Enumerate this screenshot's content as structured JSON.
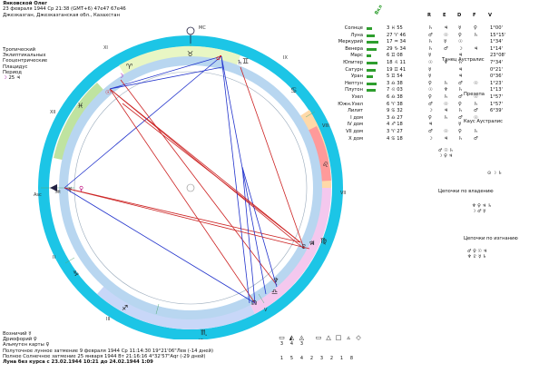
{
  "header": {
    "name": "Янковской Олег",
    "date_line": "23 февраля 1944 Ср 21:38 (GMT+6) 47e47 67e46",
    "place": "Джезказган, Джезказганская обл., Казахстан",
    "system_lines": [
      "Тропический",
      "Эклиптикальных",
      "Геоцентрические",
      "Плацидус"
    ],
    "period_label": "Период",
    "period_value": "25"
  },
  "wheel": {
    "houses": {
      "mc": "MC",
      "asc": "Asc",
      "cusp_labels": [
        "XI",
        "XII",
        "II",
        "III",
        "IC",
        "V",
        "VI",
        "VII",
        "VIII",
        "IX"
      ]
    },
    "colors": {
      "ring": "#1cc5e6",
      "sector_a": "#ffd9a8",
      "sector_b": "#e8f6c4",
      "sector_c": "#f4c8ee",
      "sector_d": "#c8d7f8",
      "sector_e": "#ffd6d6"
    }
  },
  "table": {
    "headers": [
      "Вкл",
      "R",
      "E",
      "D",
      "F",
      "V"
    ],
    "rows": [
      {
        "name": "Солнце",
        "power": 0.4,
        "pos": "3 ♓ 55",
        "c1": "♄",
        "c2": "♃",
        "c3": "☿",
        "c4": "♀",
        "angle": "1°00'"
      },
      {
        "name": "Луна",
        "power": 0.55,
        "pos": "27 ♈ 46",
        "c1": "♂",
        "c2": "☉",
        "c3": "♀",
        "c4": "♄",
        "angle": "15°15'"
      },
      {
        "name": "Меркурий",
        "power": 0.8,
        "pos": "17 ♒ 34",
        "c1": "♄",
        "c2": "☿",
        "c3": "☉",
        "c4": "",
        "angle": "1°34'"
      },
      {
        "name": "Венера",
        "power": 0.7,
        "pos": "29 ♑ 34",
        "c1": "♄",
        "c2": "♂",
        "c3": "☽",
        "c4": "♃",
        "angle": "1°14'"
      },
      {
        "name": "Марс",
        "power": 0.3,
        "pos": "6 ♊ 08",
        "c1": "☿",
        "c2": "",
        "c3": "♃",
        "c4": "",
        "angle": "23°08'"
      },
      {
        "name": "Юпитер",
        "power": 0.75,
        "pos": "18 ♌ 11",
        "c1": "☉",
        "c2": "♆",
        "c3": "♄",
        "c4": "",
        "angle": "7°34'"
      },
      {
        "name": "Сатурн",
        "power": 0.6,
        "pos": "19 ♊ 41",
        "c1": "☿",
        "c2": "",
        "c3": "♃",
        "c4": "",
        "angle": "0°21'"
      },
      {
        "name": "Уран",
        "power": 0.45,
        "pos": "5 ♊ 54",
        "c1": "☿",
        "c2": "",
        "c3": "♃",
        "c4": "",
        "angle": "0°36'"
      },
      {
        "name": "Нептун",
        "power": 0.7,
        "pos": "3 ♎ 38",
        "c1": "♀",
        "c2": "♄",
        "c3": "♂",
        "c4": "☉",
        "angle": "1°23'"
      },
      {
        "name": "Плутон",
        "power": 0.65,
        "pos": "7 ♌ 03",
        "c1": "☉",
        "c2": "♆",
        "c3": "♄",
        "c4": "",
        "angle": "1°13'"
      },
      {
        "name": "Узел",
        "power": 0,
        "pos": "6 ♎ 38",
        "c1": "♀",
        "c2": "♄",
        "c3": "♂",
        "c4": "☉",
        "angle": "1°57'"
      },
      {
        "name": "Южн.Узел",
        "power": 0,
        "pos": "6 ♈ 38",
        "c1": "♂",
        "c2": "☉",
        "c3": "♀",
        "c4": "♄",
        "angle": "1°57'"
      },
      {
        "name": "Лилит",
        "power": 0,
        "pos": "9 ♋ 32",
        "c1": "☽",
        "c2": "♃",
        "c3": "♄",
        "c4": "♂",
        "angle": "6°39'"
      },
      {
        "name": "I дом",
        "power": 0,
        "pos": "3 ♎ 27",
        "c1": "♀",
        "c2": "♄",
        "c3": "♂",
        "c4": "☉",
        "angle": ""
      },
      {
        "name": "IV дом",
        "power": 0,
        "pos": "4 ♐ 18",
        "c1": "♃",
        "c2": "",
        "c3": "☿",
        "c4": "",
        "angle": ""
      },
      {
        "name": "VII дом",
        "power": 0,
        "pos": "3 ♈ 27",
        "c1": "♂",
        "c2": "☉",
        "c3": "♀",
        "c4": "♄",
        "angle": ""
      },
      {
        "name": "X дом",
        "power": 0,
        "pos": "4 ♋ 18",
        "c1": "☽",
        "c2": "♃",
        "c3": "♄",
        "c4": "♂",
        "angle": ""
      }
    ],
    "side_notes": [
      "Танец Аустралис",
      "Презепа",
      "Каус Аустралис"
    ]
  },
  "patterns": {
    "by_owner": "Цепочки по владению",
    "by_exalt": "Цепочки по изгнанию"
  },
  "footer": {
    "lines": [
      "Возничий ☿",
      "Дриофорий ♀",
      "Альмутен карты ♀",
      "Полуточное лунное затмение 9 февраля 1944 Ср 11:14:30 19°21'06\"Лев (-14 дней)",
      "Полное Солнечное затмение 25 января 1944 Вт 21:16:16 4°32'57\"Aqr (-29 дней)"
    ],
    "bold_line": "Луна без курса с 23.02.1944 10:21 до 24.02.1944 1:09"
  },
  "pattern_strip": {
    "icons": [
      "▭",
      "◭",
      "◬",
      "▭",
      "△",
      "□",
      "▵",
      "◇"
    ],
    "counts_top": [
      "3",
      "4",
      "3"
    ],
    "counts_bottom": [
      "1",
      "5",
      "4",
      "2",
      "3",
      "2",
      "1",
      "8"
    ]
  }
}
